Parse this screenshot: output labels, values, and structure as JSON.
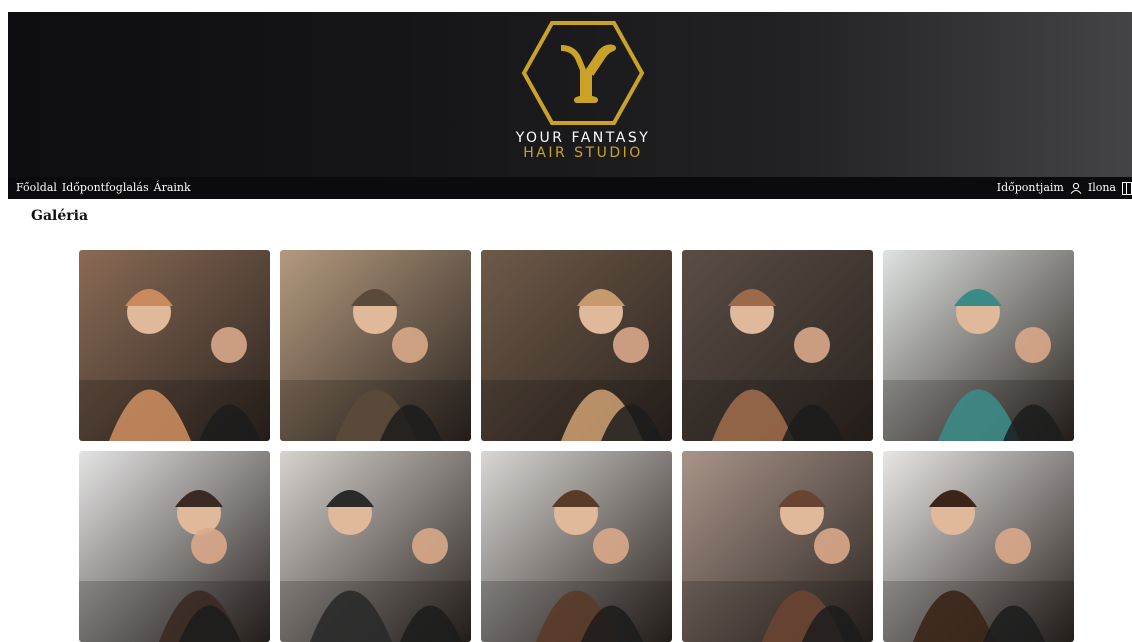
{
  "brand": {
    "line1": "YOUR FANTASY",
    "line2": "HAIR STUDIO",
    "logo_letter": "Y",
    "logo_icon": "hexagon-y-logo-icon",
    "gold": "#c9a227"
  },
  "nav": {
    "left": [
      "Főoldal",
      "Időpontfoglalás",
      "Áraink"
    ],
    "appointments": "Időpontjaim",
    "user_icon": "user-icon",
    "user_name": "Ilona",
    "panel_icon": "panel-icon"
  },
  "page": {
    "title": "Galéria"
  },
  "gallery": {
    "items": [
      {
        "icon": "barber-with-client-photo",
        "bg": "#8a6a55",
        "accent": "#c98b5e"
      },
      {
        "icon": "salon-interior-photo",
        "bg": "#b49a7e",
        "accent": "#5a4a3a"
      },
      {
        "icon": "barber-cutting-hair-photo",
        "bg": "#6f5a48",
        "accent": "#c79a6e"
      },
      {
        "icon": "stylist-curly-hair-photo",
        "bg": "#5a4d45",
        "accent": "#9b6a4b"
      },
      {
        "icon": "bright-salon-interior-photo",
        "bg": "#dfe3e1",
        "accent": "#3c8a86"
      },
      {
        "icon": "masked-stylist-photo",
        "bg": "#e4e4e4",
        "accent": "#3a2a22"
      },
      {
        "icon": "barber-shop-photo",
        "bg": "#d6d2cd",
        "accent": "#2a2a2a"
      },
      {
        "icon": "masked-barber-photo",
        "bg": "#d9d6d3",
        "accent": "#5a3b28"
      },
      {
        "icon": "stylist-and-client-photo",
        "bg": "#a8958a",
        "accent": "#6a4432"
      },
      {
        "icon": "masked-hairdresser-photo",
        "bg": "#e8e6e4",
        "accent": "#3a2518"
      }
    ]
  }
}
